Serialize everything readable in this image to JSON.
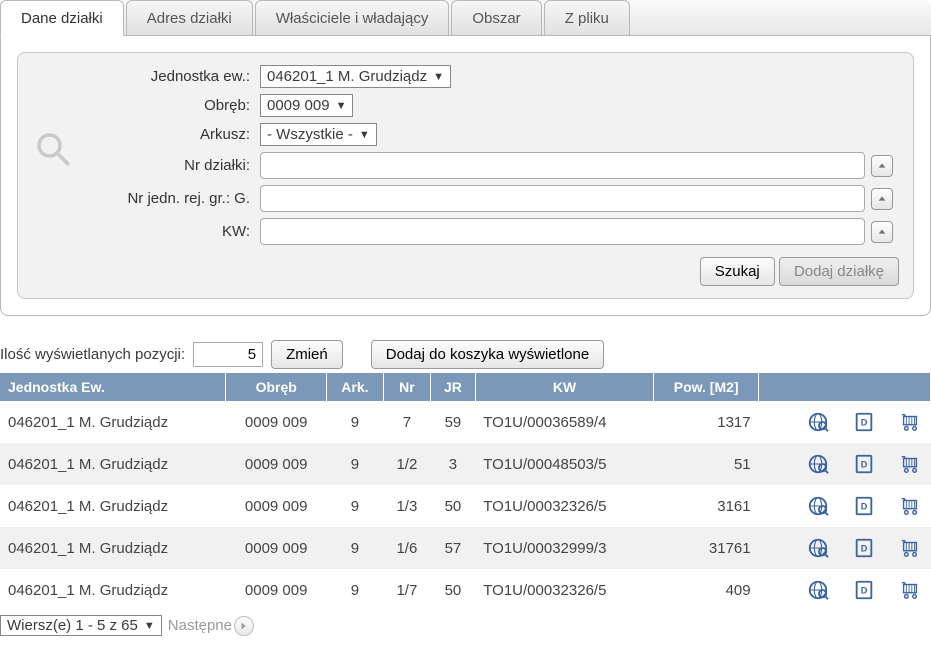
{
  "tabs": {
    "dane_dzialki": "Dane działki",
    "adres_dzialki": "Adres działki",
    "wlasciciele": "Właściciele i władający",
    "obszar": "Obszar",
    "z_pliku": "Z pliku"
  },
  "form": {
    "labels": {
      "jednostka_ew": "Jednostka ew.:",
      "obreb": "Obręb:",
      "arkusz": "Arkusz:",
      "nr_dzialki": "Nr działki:",
      "nr_jedn_rej": "Nr jedn. rej. gr.: G.",
      "kw": "KW:"
    },
    "values": {
      "jednostka_ew": "046201_1 M. Grudziądz",
      "obreb": "0009 009",
      "arkusz": "- Wszystkie -",
      "nr_dzialki": "",
      "nr_jedn_rej": "",
      "kw": ""
    },
    "buttons": {
      "szukaj": "Szukaj",
      "dodaj_dzialke": "Dodaj działkę"
    }
  },
  "toolbar": {
    "display_count_label": "Ilość wyświetlanych pozycji:",
    "display_count_value": "5",
    "zmien": "Zmień",
    "dodaj_do_koszyka": "Dodaj do koszyka wyświetlone"
  },
  "table": {
    "headers": {
      "jednostka": "Jednostka Ew.",
      "obreb": "Obręb",
      "ark": "Ark.",
      "nr": "Nr",
      "jr": "JR",
      "kw": "KW",
      "pow": "Pow. [M2]"
    },
    "rows": [
      {
        "jednostka": "046201_1 M. Grudziądz",
        "obreb": "0009 009",
        "ark": "9",
        "nr": "7",
        "jr": "59",
        "kw": "TO1U/00036589/4",
        "pow": "1317"
      },
      {
        "jednostka": "046201_1 M. Grudziądz",
        "obreb": "0009 009",
        "ark": "9",
        "nr": "1/2",
        "jr": "3",
        "kw": "TO1U/00048503/5",
        "pow": "51"
      },
      {
        "jednostka": "046201_1 M. Grudziądz",
        "obreb": "0009 009",
        "ark": "9",
        "nr": "1/3",
        "jr": "50",
        "kw": "TO1U/00032326/5",
        "pow": "3161"
      },
      {
        "jednostka": "046201_1 M. Grudziądz",
        "obreb": "0009 009",
        "ark": "9",
        "nr": "1/6",
        "jr": "57",
        "kw": "TO1U/00032999/3",
        "pow": "31761"
      },
      {
        "jednostka": "046201_1 M. Grudziądz",
        "obreb": "0009 009",
        "ark": "9",
        "nr": "1/7",
        "jr": "50",
        "kw": "TO1U/00032326/5",
        "pow": "409"
      }
    ]
  },
  "pager": {
    "range": "Wiersz(e) 1 - 5 z 65",
    "next": "Następne"
  }
}
